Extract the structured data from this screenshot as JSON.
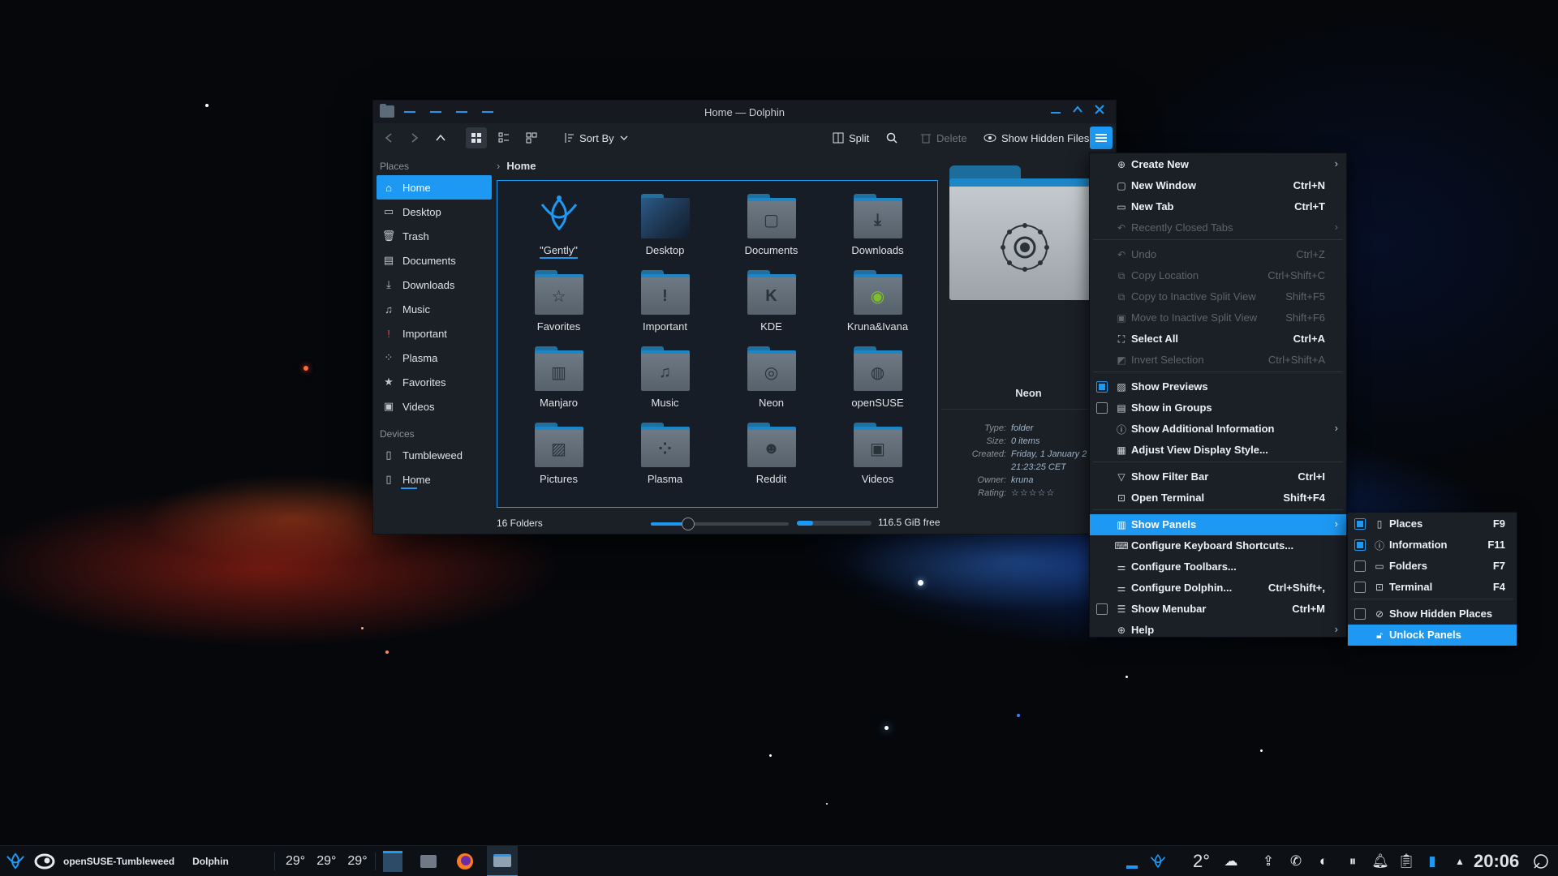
{
  "window": {
    "title": "Home — Dolphin"
  },
  "toolbar": {
    "sort_by": "Sort By",
    "split": "Split",
    "delete": "Delete",
    "show_hidden_files": "Show Hidden Files"
  },
  "places": {
    "title": "Places",
    "items": [
      {
        "label": "Home",
        "icon": "home-icon"
      },
      {
        "label": "Desktop",
        "icon": "desktop-icon"
      },
      {
        "label": "Trash",
        "icon": "trash-icon"
      },
      {
        "label": "Documents",
        "icon": "document-icon"
      },
      {
        "label": "Downloads",
        "icon": "download-icon"
      },
      {
        "label": "Music",
        "icon": "music-icon"
      },
      {
        "label": "Important",
        "icon": "important-icon"
      },
      {
        "label": "Plasma",
        "icon": "plasma-icon"
      },
      {
        "label": "Favorites",
        "icon": "star-icon"
      },
      {
        "label": "Videos",
        "icon": "video-icon"
      }
    ],
    "devices_title": "Devices",
    "devices": [
      {
        "label": "Tumbleweed",
        "icon": "drive-icon"
      },
      {
        "label": "Home",
        "icon": "drive-icon"
      }
    ]
  },
  "breadcrumb": {
    "current": "Home"
  },
  "files": [
    {
      "name": "\"Gently\"",
      "icon": "gently-logo"
    },
    {
      "name": "Desktop",
      "icon": "desktop-folder"
    },
    {
      "name": "Documents",
      "icon": "document-folder"
    },
    {
      "name": "Downloads",
      "icon": "download-folder"
    },
    {
      "name": "Favorites",
      "icon": "star-folder"
    },
    {
      "name": "Important",
      "icon": "important-folder"
    },
    {
      "name": "KDE",
      "icon": "kde-folder"
    },
    {
      "name": "Kruna&Ivana",
      "icon": "chameleon-folder"
    },
    {
      "name": "Manjaro",
      "icon": "manjaro-folder"
    },
    {
      "name": "Music",
      "icon": "music-folder"
    },
    {
      "name": "Neon",
      "icon": "neon-folder"
    },
    {
      "name": "openSUSE",
      "icon": "opensuse-folder"
    },
    {
      "name": "Pictures",
      "icon": "pictures-folder"
    },
    {
      "name": "Plasma",
      "icon": "plasma-folder"
    },
    {
      "name": "Reddit",
      "icon": "reddit-folder"
    },
    {
      "name": "Videos",
      "icon": "video-folder"
    }
  ],
  "info_panel": {
    "name": "Neon",
    "type_label": "Type:",
    "type": "folder",
    "size_label": "Size:",
    "size": "0 items",
    "created_label": "Created:",
    "created": "Friday, 1 January 2",
    "created_time": "21:23:25 CET",
    "owner_label": "Owner:",
    "owner": "kruna",
    "rating_label": "Rating:",
    "rating": "☆☆☆☆☆"
  },
  "status": {
    "count": "16 Folders",
    "zoom_level": 0.27,
    "free": "116.5 GiB free",
    "used_fraction": 0.22
  },
  "main_menu": {
    "items": [
      {
        "label": "Create New",
        "shortcut": "",
        "submenu": true
      },
      {
        "label": "New Window",
        "shortcut": "Ctrl+N"
      },
      {
        "label": "New Tab",
        "shortcut": "Ctrl+T"
      },
      {
        "label": "Recently Closed Tabs",
        "shortcut": "",
        "submenu": true,
        "disabled": true
      },
      {
        "label": "Undo",
        "shortcut": "Ctrl+Z",
        "disabled": true
      },
      {
        "label": "Copy Location",
        "shortcut": "Ctrl+Shift+C",
        "disabled": true
      },
      {
        "label": "Copy to Inactive Split View",
        "shortcut": "Shift+F5",
        "disabled": true
      },
      {
        "label": "Move to Inactive Split View",
        "shortcut": "Shift+F6",
        "disabled": true
      },
      {
        "label": "Select All",
        "shortcut": "Ctrl+A"
      },
      {
        "label": "Invert Selection",
        "shortcut": "Ctrl+Shift+A",
        "disabled": true
      },
      {
        "label": "Show Previews",
        "shortcut": "",
        "checked": true
      },
      {
        "label": "Show in Groups",
        "shortcut": "",
        "checked": false
      },
      {
        "label": "Show Additional Information",
        "shortcut": "",
        "submenu": true
      },
      {
        "label": "Adjust View Display Style...",
        "shortcut": ""
      },
      {
        "label": "Show Filter Bar",
        "shortcut": "Ctrl+I"
      },
      {
        "label": "Open Terminal",
        "shortcut": "Shift+F4"
      },
      {
        "label": "Show Panels",
        "shortcut": "",
        "submenu": true,
        "highlighted": true
      },
      {
        "label": "Configure Keyboard Shortcuts...",
        "shortcut": ""
      },
      {
        "label": "Configure Toolbars...",
        "shortcut": ""
      },
      {
        "label": "Configure Dolphin...",
        "shortcut": "Ctrl+Shift+,"
      },
      {
        "label": "Show Menubar",
        "shortcut": "Ctrl+M",
        "checked": false
      },
      {
        "label": "Help",
        "shortcut": "",
        "submenu": true
      }
    ]
  },
  "panels_menu": {
    "items": [
      {
        "label": "Places",
        "shortcut": "F9",
        "checked": true
      },
      {
        "label": "Information",
        "shortcut": "F11",
        "checked": true
      },
      {
        "label": "Folders",
        "shortcut": "F7",
        "checked": false
      },
      {
        "label": "Terminal",
        "shortcut": "F4",
        "checked": false
      },
      {
        "label": "Show Hidden Places",
        "shortcut": "",
        "checked": false
      },
      {
        "label": "Unlock Panels",
        "shortcut": "",
        "highlighted": true
      }
    ]
  },
  "taskbar": {
    "distro": "openSUSE-Tumbleweed",
    "active_app": "Dolphin",
    "temps": [
      "29°",
      "29°",
      "29°"
    ],
    "weather_temp": "2°",
    "clock": "20:06"
  },
  "colors": {
    "accent": "#1d99f3",
    "window_bg": "#1b1f26",
    "taskbar_bg": "#0d1014"
  }
}
